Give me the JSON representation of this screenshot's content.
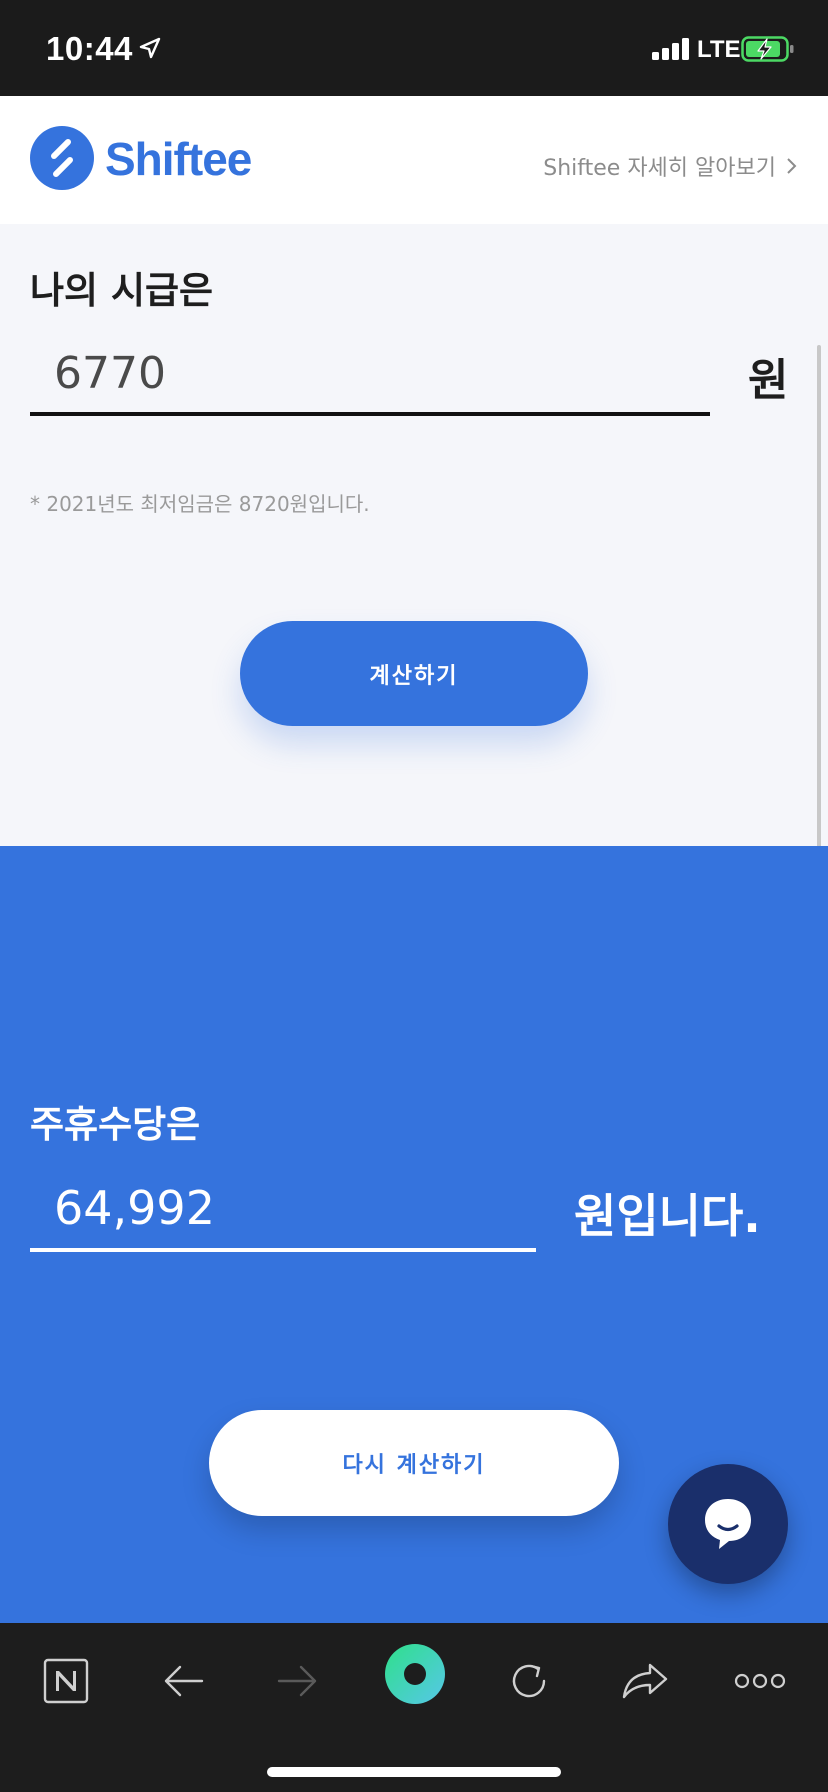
{
  "status_bar": {
    "time": "10:44",
    "network": "LTE",
    "icons": [
      "location-arrow-icon",
      "signal-icon",
      "battery-charging-icon"
    ]
  },
  "header": {
    "brand_name": "Shiftee",
    "learn_more_label": "Shiftee 자세히 알아보기",
    "learn_more_icon": "chevron-right-icon"
  },
  "input_section": {
    "heading": "나의 시급은",
    "wage_value": "6770",
    "unit": "원",
    "min_wage_note": "* 2021년도 최저임금은 8720원입니다.",
    "calculate_label": "계산하기"
  },
  "result_section": {
    "heading": "주휴수당은",
    "amount": "64,992",
    "suffix": "원입니다.",
    "recalculate_label": "다시 계산하기"
  },
  "chat_button": {
    "icon": "chat-bubble-icon"
  },
  "browser_toolbar": {
    "icons": [
      "naver-n-icon",
      "back-arrow-icon",
      "forward-arrow-icon",
      "home-circle-icon",
      "reload-icon",
      "share-icon",
      "more-icon"
    ]
  },
  "colors": {
    "brand_blue": "#3573dd",
    "dark_navy": "#1a2f6b",
    "toolbar_bg": "#1d1d1d",
    "section_bg": "#f5f6fa"
  }
}
